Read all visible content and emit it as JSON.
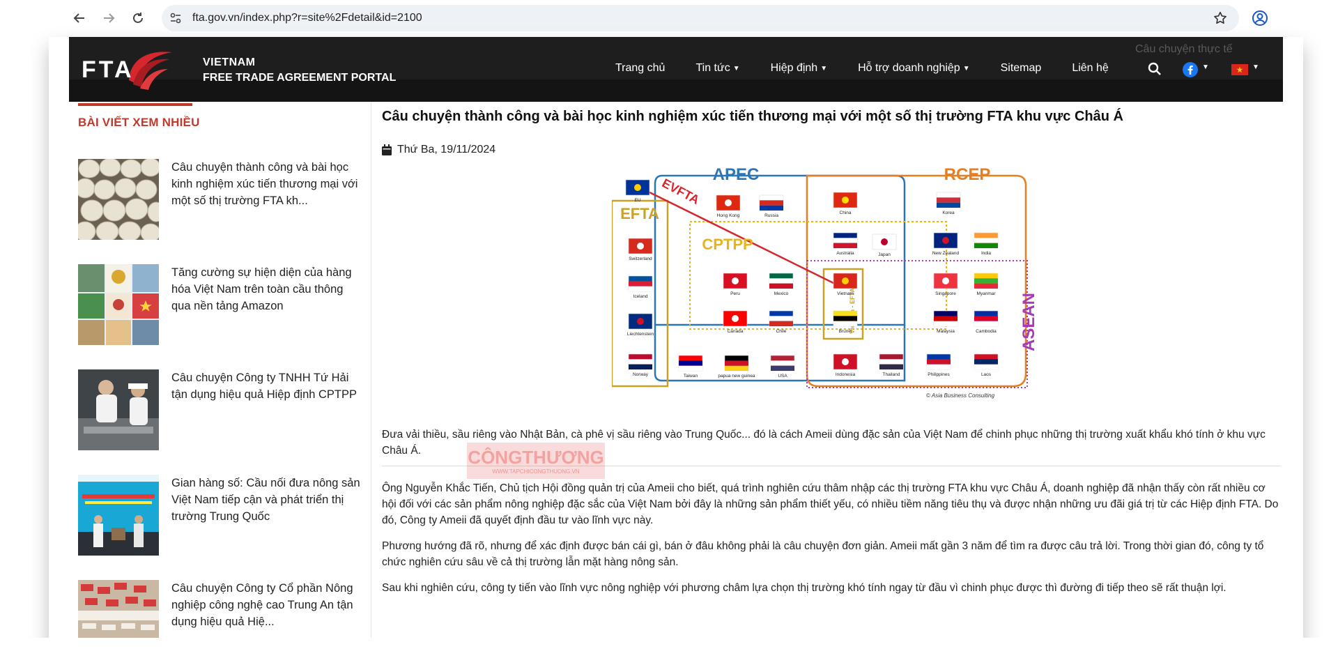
{
  "browser": {
    "url": "fta.gov.vn/index.php?r=site%2Fdetail&id=2100"
  },
  "header": {
    "logo_text": "FTA",
    "portal_line1": "VIETNAM",
    "portal_line2": "FREE TRADE AGREEMENT PORTAL",
    "ghost_text": "Câu chuyện thực tế",
    "nav": [
      {
        "label": "Trang chủ",
        "dropdown": false
      },
      {
        "label": "Tin tức",
        "dropdown": true
      },
      {
        "label": "Hiệp định",
        "dropdown": true
      },
      {
        "label": "Hỗ trợ doanh nghiệp",
        "dropdown": true
      },
      {
        "label": "Sitemap",
        "dropdown": false
      },
      {
        "label": "Liên hệ",
        "dropdown": false
      }
    ]
  },
  "sidebar": {
    "title": "BÀI VIẾT XEM NHIỀU",
    "items": [
      {
        "title": "Câu chuyện thành công và bài học kinh nghiệm xúc tiến thương mại với một số thị trường FTA kh..."
      },
      {
        "title": "Tăng cường sự hiện diện của hàng hóa Việt Nam trên toàn cầu thông qua nền tảng Amazon"
      },
      {
        "title": "Câu chuyện Công ty TNHH Tứ Hải tận dụng hiệu quả Hiệp định CPTPP"
      },
      {
        "title": "Gian hàng số: Cầu nối đưa nông sản Việt Nam tiếp cận và phát triển thị trường Trung Quốc"
      },
      {
        "title": "Câu chuyện Công ty Cổ phần Nông nghiệp công nghệ cao Trung An tận dụng hiệu quả Hiệ..."
      }
    ]
  },
  "article": {
    "title": "Câu chuyện thành công và bài học kinh nghiệm xúc tiến thương mại với một số thị trường FTA khu vực Châu Á",
    "date": "Thứ Ba, 19/11/2024",
    "infographic": {
      "groups": [
        "APEC",
        "RCEP",
        "EFTA",
        "CPTPP",
        "ASEAN",
        "EVFTA",
        "Vietnam - EFTA"
      ],
      "countries": [
        "EU",
        "Hong Kong",
        "Russia",
        "China",
        "Korea",
        "Switzerland",
        "Iceland",
        "Liechtenstein",
        "Norway",
        "Australia",
        "Japan",
        "New Zealand",
        "India",
        "Peru",
        "Mexico",
        "Vietnam",
        "Singapore",
        "Myanmar",
        "Canada",
        "Chile",
        "Brunei",
        "Malaysia",
        "Cambodia",
        "Taiwan",
        "papua new guinea",
        "USA",
        "Indonesia",
        "Thailand",
        "Philippines",
        "Laos"
      ],
      "credit": "© Asia Business Consulting",
      "colors": {
        "apec": "#2e75b6",
        "rcep": "#e67e22",
        "efta": "#c9a227",
        "cptpp": "#e8b41c",
        "asean": "#a83bb3",
        "evfta": "#d6262e"
      }
    },
    "paragraphs": [
      "Đưa vải thiều, sầu riêng vào Nhật Bản, cà phê vị sầu riêng vào Trung Quốc... đó là cách Ameii dùng đặc sản của Việt Nam để chinh phục những thị trường xuất khẩu khó tính ở khu vực Châu Á.",
      "Ông Nguyễn Khắc Tiến, Chủ tịch Hội đồng quản trị của Ameii cho biết, quá trình nghiên cứu thâm nhập các thị trường FTA khu vực Châu Á, doanh nghiệp đã nhận thấy còn rất nhiều cơ hội đối với các sản phẩm nông nghiệp đặc sắc của Việt Nam bởi đây là những sản phẩm thiết yếu, có nhiều tiềm năng tiêu thụ và được nhận những ưu đãi giá trị từ các Hiệp định FTA. Do đó, Công ty Ameii đã quyết định đầu tư vào lĩnh vực này.",
      "Phương hướng đã rõ, nhưng để xác định được bán cái gì, bán ở đâu không phải là câu chuyện đơn giản. Ameii mất gần 3 năm để tìm ra được câu trả lời. Trong thời gian đó, công ty tổ chức nghiên cứu sâu về cả thị trường lẫn mặt hàng nông sản.",
      " Sau khi nghiên cứu, công ty tiến vào lĩnh vực nông nghiệp với phương châm lựa chọn thị trường khó tính ngay từ đầu vì chinh phục được thì đường đi tiếp theo sẽ rất thuận lợi."
    ],
    "watermark_title": "CÔNGTHƯƠNG",
    "watermark_sub": "WWW.TAPCHICONGTHUONG.VN"
  }
}
